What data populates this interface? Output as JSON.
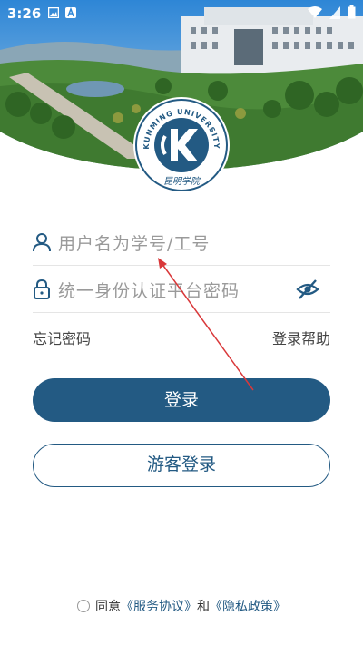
{
  "status_bar": {
    "time": "3:26"
  },
  "logo": {
    "name_text": "KUNMING UNIVERSITY",
    "seal_text": "昆明学院"
  },
  "form": {
    "username_placeholder": "用户名为学号/工号",
    "password_placeholder": "统一身份认证平台密码",
    "forgot_password": "忘记密码",
    "login_help": "登录帮助",
    "login_button": "登录",
    "guest_button": "游客登录"
  },
  "footer": {
    "agree_prefix": "同意",
    "service_agreement": "《服务协议》",
    "and": "和",
    "privacy_policy": "《隐私政策》"
  },
  "colors": {
    "brand": "#235a83",
    "annotation_arrow": "#d9383a"
  },
  "icons": {
    "username": "user-icon",
    "password": "lock-icon",
    "toggle_visibility": "eye-off-icon"
  }
}
